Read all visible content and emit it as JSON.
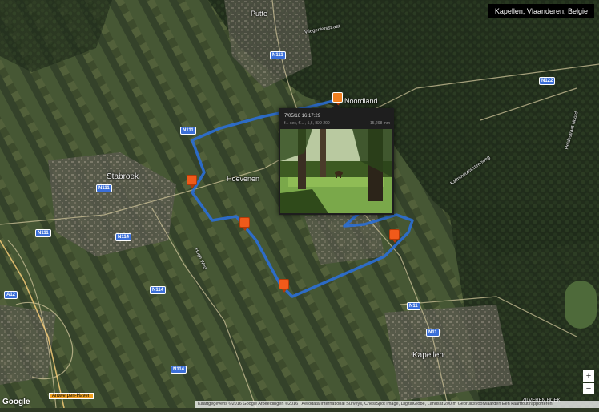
{
  "location": "Kapellen, Vlaanderen, Belgie",
  "popup": {
    "date": "7/05/16 16:17:29",
    "meta": "f... sec, f/... , 5,6, ISO 200",
    "focal": "15,298 mm"
  },
  "places": {
    "putte": "Putte",
    "stabroek": "Stabroek",
    "hoevenen": "Hoevenen",
    "kapellen": "Kapellen",
    "zilveren_hoek": "ZILVEREN HOEK",
    "noordland": "Noordland",
    "street_vliegeniersstraat": "Vliegeniersstraat",
    "street_kalmthoutsesteenweg": "Kalmthoutsesteenweg",
    "street_heidestraat": "Heidestraat Noord",
    "street_hoogeweg": "Hoge Weg"
  },
  "roads": {
    "n111_a": "N111",
    "n111_b": "N111",
    "n111_c": "N111",
    "n111_d": "N111",
    "n114_a": "N114",
    "n114_b": "N114",
    "n114_c": "N114",
    "n11_a": "N11",
    "n11_b": "N11",
    "n122": "N122",
    "a12": "A12"
  },
  "zoom": {
    "in": "+",
    "out": "−"
  },
  "google_logo": "Google",
  "highway_sign": "Antwerpen-Haven",
  "attribution": "Kaartgegevens ©2016 Google Afbeeldingen ©2016 , Aerodata International Surveys, Cnes/Spot Image, DigitalGlobe, Landsat   200 m   Gebruiksvoorwaarden   Een kaartfout rapporteren",
  "colors": {
    "track": "#2b6fd6",
    "marker": "#f05a1a",
    "accent": "#3b6fd8"
  }
}
